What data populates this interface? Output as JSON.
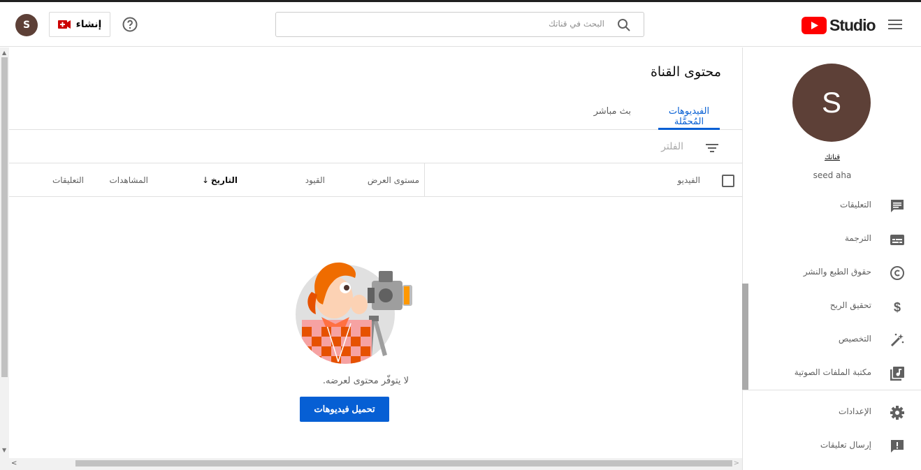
{
  "header": {
    "create_label": "إنشاء",
    "avatar_initial": "S",
    "search_placeholder": "البحث في قناتك",
    "logo_text": "Studio"
  },
  "main": {
    "page_title": "محتوى القناة",
    "tabs": [
      {
        "label": "الفيديوهات المُحمَّلة",
        "active": true
      },
      {
        "label": "بث مباشر",
        "active": false
      }
    ],
    "filter_label": "الفلتر",
    "columns": {
      "video": "الفيديو",
      "visibility": "مستوى العرض",
      "restrictions": "القيود",
      "date": "التاريخ",
      "views": "المشاهدات",
      "comments": "التعليقات"
    },
    "empty_text": "لا يتوفّر محتوى لعرضه.",
    "upload_button": "تحميل فيديوهات"
  },
  "sidebar": {
    "avatar_initial": "S",
    "channel_label": "قناتك",
    "channel_name": "seed aha",
    "items": [
      {
        "label": "التعليقات",
        "icon": "comment-icon"
      },
      {
        "label": "الترجمة",
        "icon": "subtitles-icon"
      },
      {
        "label": "حقوق الطبع والنشر",
        "icon": "copyright-icon"
      },
      {
        "label": "تحقيق الربح",
        "icon": "dollar-icon"
      },
      {
        "label": "التخصيص",
        "icon": "magic-wand-icon"
      },
      {
        "label": "مكتبة الملفات الصوتية",
        "icon": "audio-library-icon"
      }
    ],
    "bottom_items": [
      {
        "label": "الإعدادات",
        "icon": "gear-icon"
      },
      {
        "label": "إرسال تعليقات",
        "icon": "feedback-icon"
      }
    ]
  },
  "colors": {
    "accent": "#065fd4",
    "avatar": "#5d4037",
    "brand_red": "#ff0000"
  }
}
